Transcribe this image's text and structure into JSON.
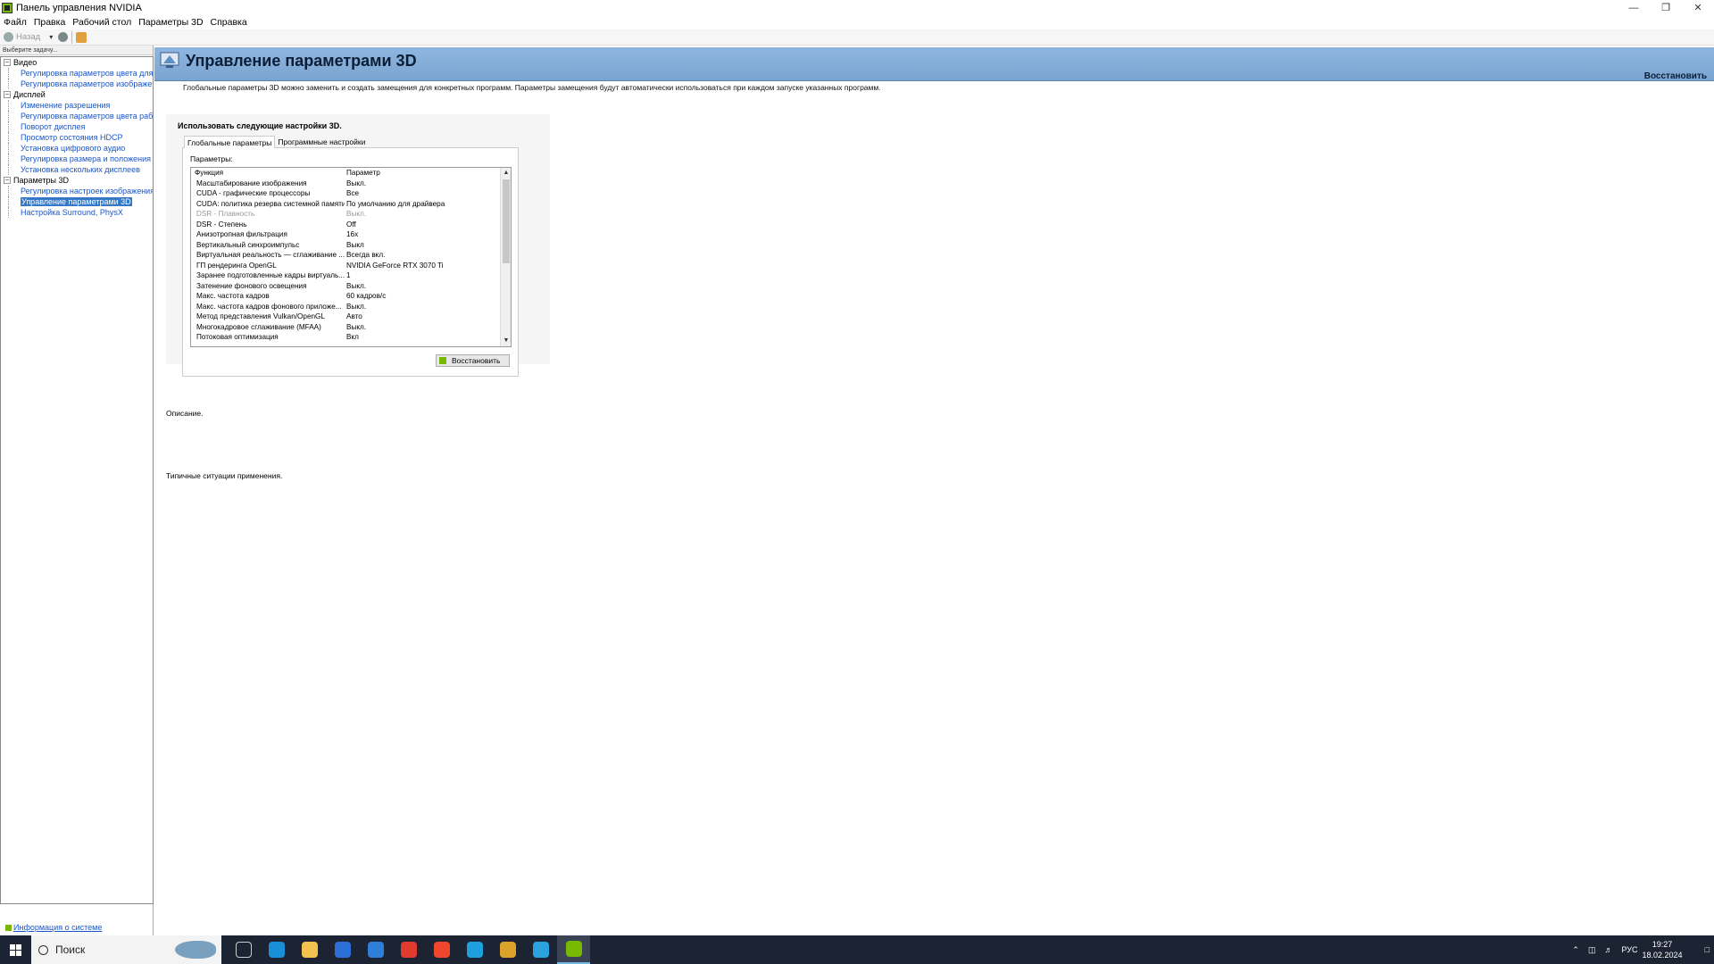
{
  "window": {
    "title": "Панель управления NVIDIA"
  },
  "menu": [
    "Файл",
    "Правка",
    "Рабочий стол",
    "Параметры 3D",
    "Справка"
  ],
  "toolbar": {
    "back_label": "Назад"
  },
  "sidebar": {
    "header": "Выберите задачу...",
    "groups": [
      {
        "label": "Видео",
        "items": [
          "Регулировка параметров цвета для видео",
          "Регулировка параметров изображения для видео"
        ]
      },
      {
        "label": "Дисплей",
        "items": [
          "Изменение разрешения",
          "Регулировка параметров цвета рабочего стола",
          "Поворот дисплея",
          "Просмотр состояния HDCP",
          "Установка цифрового аудио",
          "Регулировка размера и положения рабочего стола",
          "Установка нескольких дисплеев"
        ]
      },
      {
        "label": "Параметры 3D",
        "items": [
          "Регулировка настроек изображения с просмотром",
          "Управление параметрами 3D",
          "Настройка Surround, PhysX"
        ]
      }
    ],
    "selected": "Управление параметрами 3D",
    "system_info": "Информация о системе"
  },
  "main": {
    "title": "Управление параметрами 3D",
    "restore_link": "Восстановить",
    "intro": "Глобальные параметры 3D можно заменить и создать замещения для конкретных программ. Параметры замещения будут автоматически использоваться при каждом запуске указанных программ.",
    "panel_title": "Использовать следующие настройки 3D.",
    "tabs": [
      "Глобальные параметры",
      "Программные настройки"
    ],
    "params_label": "Параметры:",
    "grid_headers": [
      "Функция",
      "Параметр"
    ],
    "rows": [
      {
        "f": "Масштабирование изображения",
        "v": "Выкл."
      },
      {
        "f": "CUDA - графические процессоры",
        "v": "Все"
      },
      {
        "f": "CUDA: политика резерва системной памяти",
        "v": "По умолчанию для драйвера"
      },
      {
        "f": "DSR - Плавность",
        "v": "Выкл.",
        "disabled": true
      },
      {
        "f": "DSR - Степень",
        "v": "Off"
      },
      {
        "f": "Анизотропная фильтрация",
        "v": "16x"
      },
      {
        "f": "Вертикальный синхроимпульс",
        "v": "Выкл"
      },
      {
        "f": "Виртуальная реальность — сглаживание ...",
        "v": "Всегда вкл."
      },
      {
        "f": "ГП рендеринга OpenGL",
        "v": "NVIDIA GeForce RTX 3070 Ti"
      },
      {
        "f": "Заранее подготовленные кадры виртуаль...",
        "v": "1"
      },
      {
        "f": "Затенение фонового освещения",
        "v": "Выкл."
      },
      {
        "f": "Макс. частота кадров",
        "v": "60 кадров/с"
      },
      {
        "f": "Макс. частота кадров фонового приложе...",
        "v": "Выкл."
      },
      {
        "f": "Метод представления Vulkan/OpenGL",
        "v": "Авто"
      },
      {
        "f": "Многокадровое сглаживание (MFAA)",
        "v": "Выкл."
      },
      {
        "f": "Потоковая оптимизация",
        "v": "Вкл"
      }
    ],
    "restore_button": "Восстановить",
    "description_label": "Описание.",
    "usage_label": "Типичные ситуации применения."
  },
  "taskbar": {
    "search_text": "Поиск",
    "apps": [
      {
        "name": "task-view",
        "color": "#1c2333"
      },
      {
        "name": "edge",
        "color": "#1a8fd8"
      },
      {
        "name": "explorer",
        "color": "#f2c14e"
      },
      {
        "name": "store",
        "color": "#2b6fd6"
      },
      {
        "name": "mail",
        "color": "#2f7fd8"
      },
      {
        "name": "yandex-browser",
        "color": "#e23a2e"
      },
      {
        "name": "yandex",
        "color": "#f0452f"
      },
      {
        "name": "skype",
        "color": "#1d9fe0"
      },
      {
        "name": "chrome",
        "color": "#dba32a"
      },
      {
        "name": "telegram",
        "color": "#2aa3df"
      },
      {
        "name": "nvidia",
        "color": "#76b900"
      }
    ],
    "lang": "РУС",
    "time": "19:27",
    "date": "18.02.2024"
  }
}
